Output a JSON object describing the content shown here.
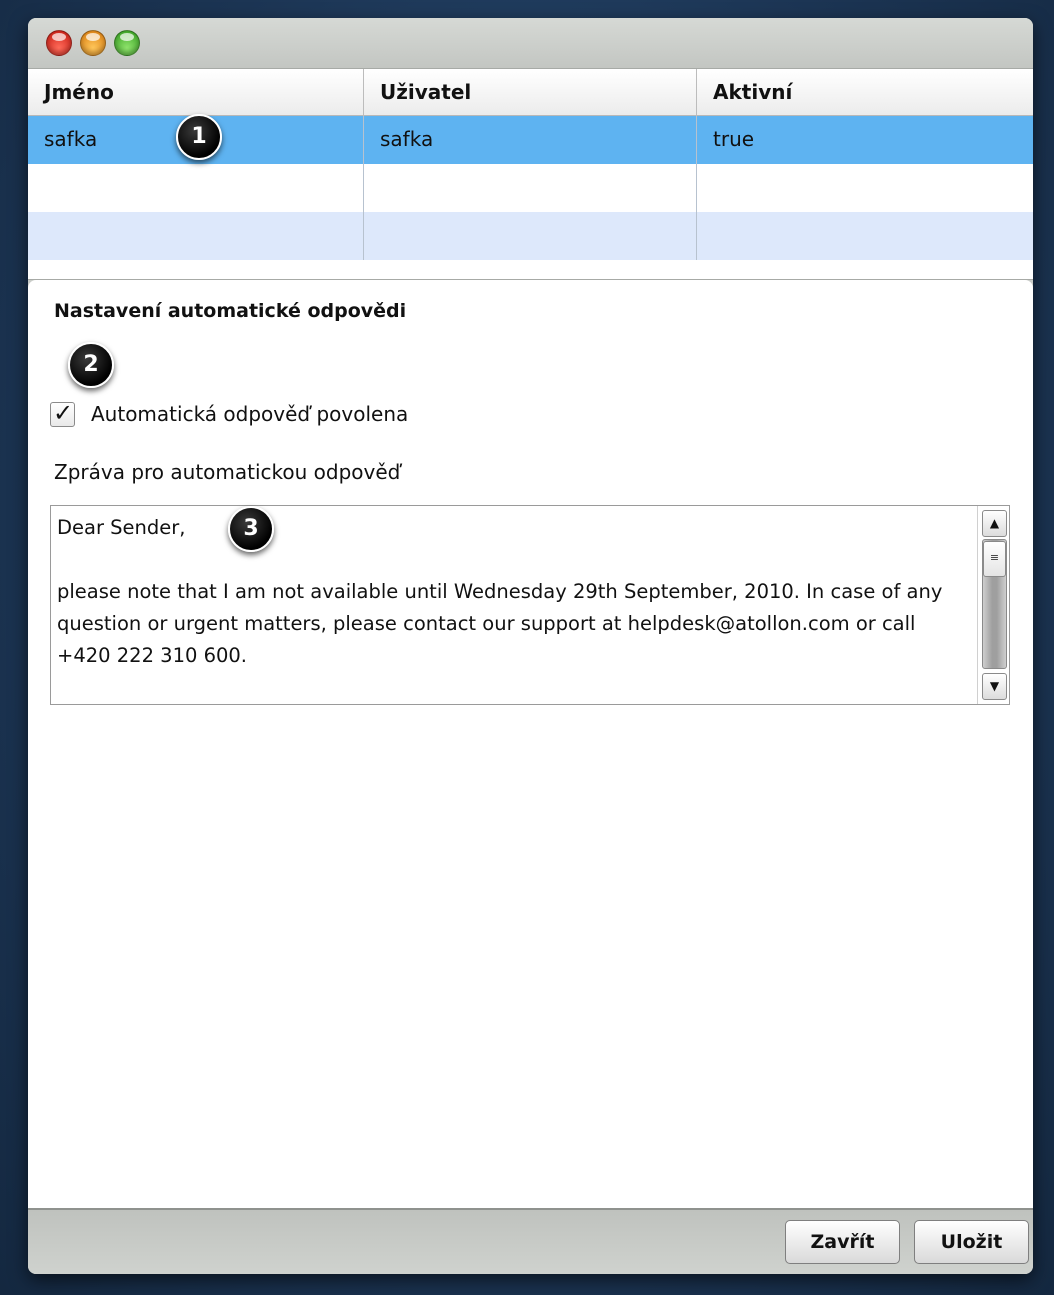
{
  "table": {
    "columns": [
      "Jméno",
      "Uživatel",
      "Aktivní"
    ],
    "rows": [
      {
        "name": "safka",
        "user": "safka",
        "active": "true"
      }
    ]
  },
  "panel": {
    "title": "Nastavení automatické odpovědi",
    "checkbox_label": "Automatická odpověď povolena",
    "checkbox_checked": true,
    "checkbox_mark": "✓",
    "message_label": "Zpráva pro automatickou odpověď",
    "message_text": "Dear Sender,\n\nplease note that I am not available until Wednesday 29th September, 2010. In case of any question or urgent matters, please contact our support at helpdesk@atollon.com or call +420 222 310 600."
  },
  "scrollbar": {
    "up_arrow": "▲",
    "down_arrow": "▼",
    "thumb_grip": "≡"
  },
  "footer": {
    "close_label": "Zavřít",
    "save_label": "Uložit"
  },
  "markers": [
    "1",
    "2",
    "3"
  ],
  "colors": {
    "selection": "#5eb3f1",
    "alt_row": "#dde8fb"
  }
}
